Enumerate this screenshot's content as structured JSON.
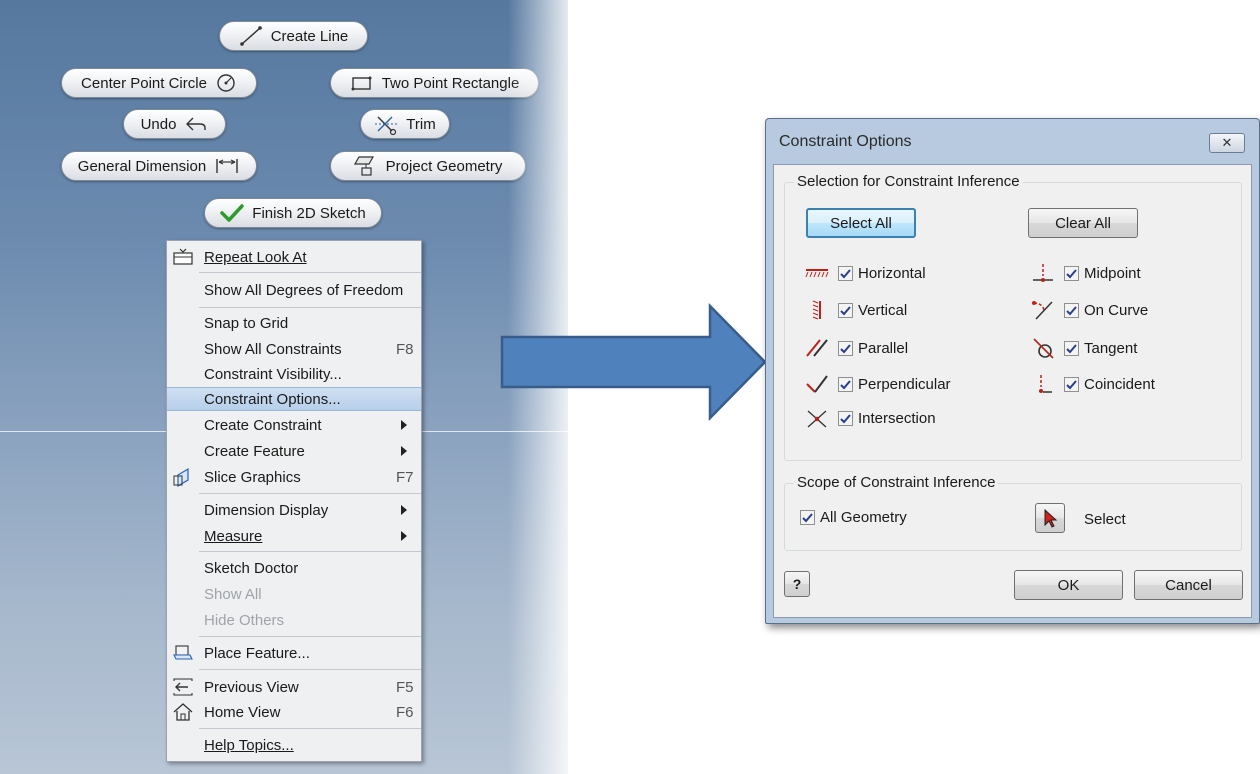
{
  "viewport": {
    "buttons": {
      "create_line": "Create Line",
      "center_point_circle": "Center Point Circle",
      "two_point_rectangle": "Two Point Rectangle",
      "undo": "Undo",
      "trim": "Trim",
      "general_dimension": "General Dimension",
      "project_geometry": "Project Geometry",
      "finish_2d_sketch": "Finish 2D Sketch"
    },
    "context_menu": {
      "repeat_look_at": "Repeat Look At",
      "show_all_dof": "Show All Degrees of Freedom",
      "snap_to_grid": "Snap to Grid",
      "show_all_constraints": "Show All Constraints",
      "show_all_constraints_shortcut": "F8",
      "constraint_visibility": "Constraint Visibility...",
      "constraint_options": "Constraint Options...",
      "create_constraint": "Create Constraint",
      "create_feature": "Create Feature",
      "slice_graphics": "Slice Graphics",
      "slice_graphics_shortcut": "F7",
      "dimension_display": "Dimension Display",
      "measure": "Measure",
      "sketch_doctor": "Sketch Doctor",
      "show_all": "Show All",
      "hide_others": "Hide Others",
      "place_feature": "Place Feature...",
      "previous_view": "Previous View",
      "previous_view_shortcut": "F5",
      "home_view": "Home View",
      "home_view_shortcut": "F6",
      "help_topics": "Help Topics..."
    }
  },
  "dialog": {
    "title": "Constraint Options",
    "selection_group": "Selection for Constraint Inference",
    "select_all": "Select All",
    "clear_all": "Clear All",
    "options": {
      "horizontal": "Horizontal",
      "vertical": "Vertical",
      "parallel": "Parallel",
      "perpendicular": "Perpendicular",
      "intersection": "Intersection",
      "midpoint": "Midpoint",
      "on_curve": "On Curve",
      "tangent": "Tangent",
      "coincident": "Coincident"
    },
    "scope_group": "Scope of Constraint Inference",
    "all_geometry": "All Geometry",
    "select": "Select",
    "ok": "OK",
    "cancel": "Cancel"
  },
  "colors": {
    "highlight": "#b7cfea",
    "dialog_frame": "#b7cadf",
    "arrow_fill": "#4f81bd",
    "constraint_icon": "#c0201a"
  }
}
